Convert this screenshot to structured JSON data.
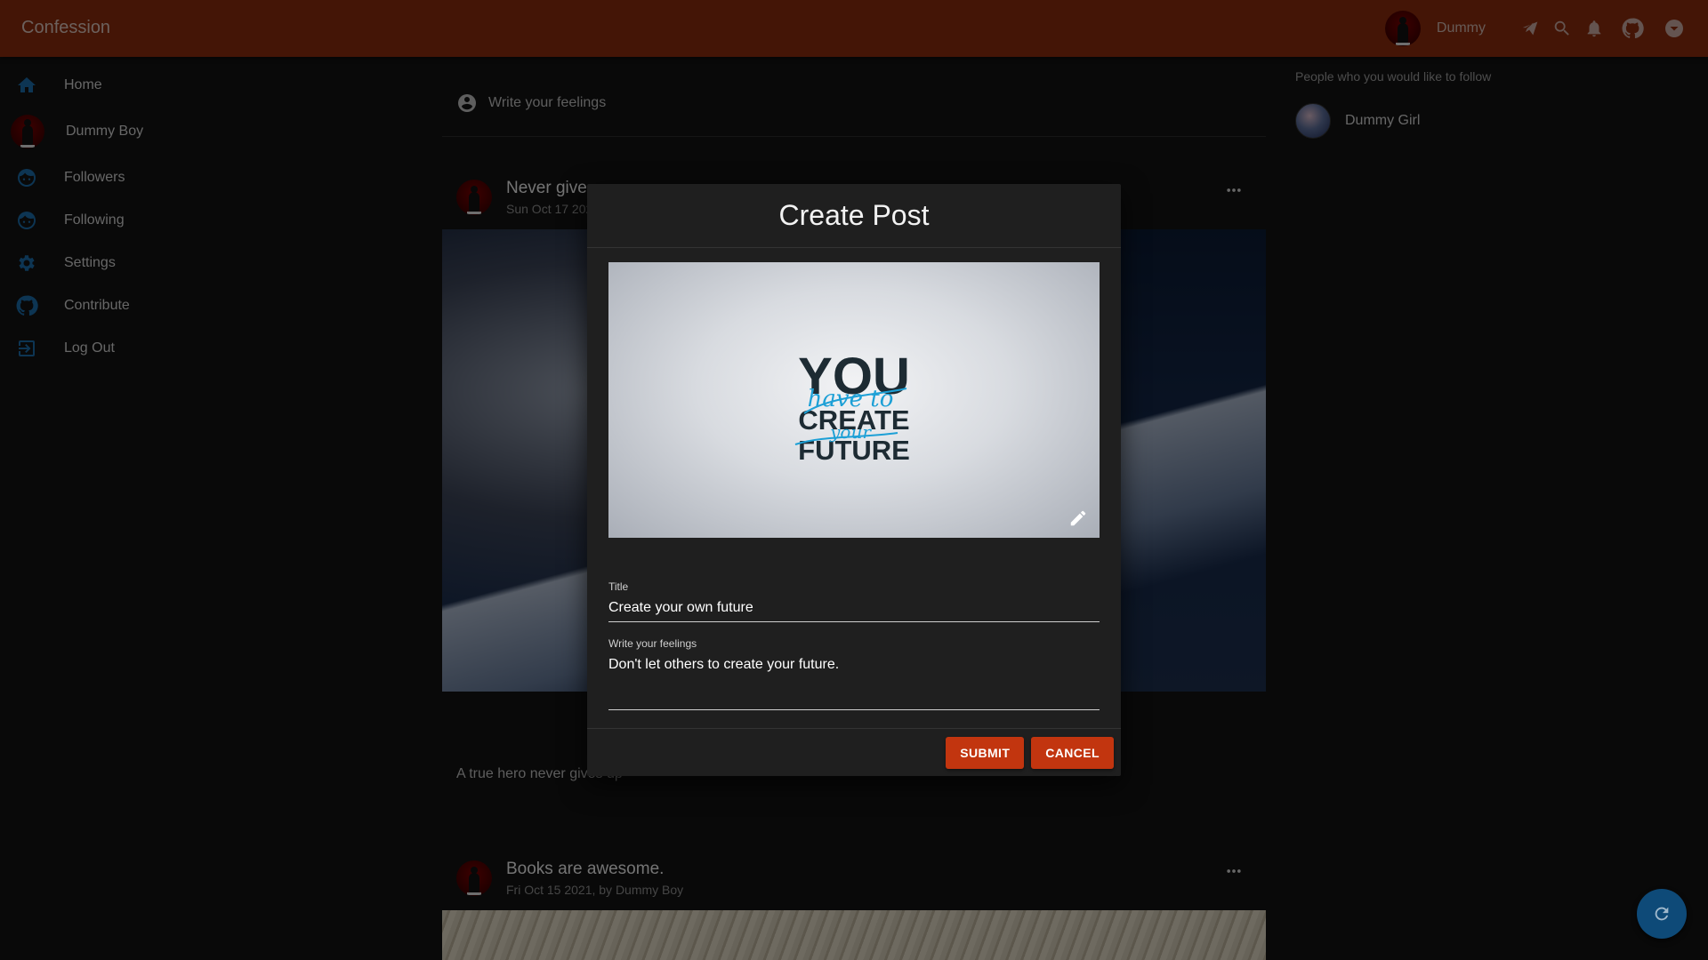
{
  "app": {
    "title": "Confession"
  },
  "header": {
    "user_name": "Dummy",
    "icons": [
      "telegram-icon",
      "search-icon",
      "bell-icon",
      "github-icon",
      "chevron-down-icon"
    ]
  },
  "nav": {
    "items": [
      {
        "label": "Home",
        "icon": "home-icon"
      },
      {
        "label": "Dummy Boy",
        "icon": "avatar"
      },
      {
        "label": "Followers",
        "icon": "followers-icon"
      },
      {
        "label": "Following",
        "icon": "following-icon"
      },
      {
        "label": "Settings",
        "icon": "gear-icon"
      },
      {
        "label": "Contribute",
        "icon": "github-icon"
      },
      {
        "label": "Log Out",
        "icon": "logout-icon"
      }
    ]
  },
  "composer": {
    "placeholder": "Write your feelings"
  },
  "posts": [
    {
      "title": "Never give",
      "meta": "Sun Oct 17 202",
      "body": "A true hero never gives up"
    },
    {
      "title": "Books are awesome.",
      "meta": "Fri Oct 15 2021, by Dummy Boy"
    }
  ],
  "suggestions": {
    "title": "People who you would like to follow",
    "people": [
      {
        "name": "Dummy Girl"
      }
    ]
  },
  "dialog": {
    "title": "Create Post",
    "image_text": {
      "line1": "YOU",
      "line2": "CREATE",
      "line3": "FUTURE",
      "script1": "have to",
      "script2": "your"
    },
    "title_field": {
      "label": "Title",
      "value": "Create your own future"
    },
    "feelings_field": {
      "label": "Write your feelings",
      "value": "Don't let others to create your future."
    },
    "submit_label": "SUBMIT",
    "cancel_label": "CANCEL"
  },
  "colors": {
    "appbar": "#892a0c",
    "accent_button": "#c2350f",
    "nav_icon": "#1b6aa7",
    "fab": "#0e4a78"
  }
}
